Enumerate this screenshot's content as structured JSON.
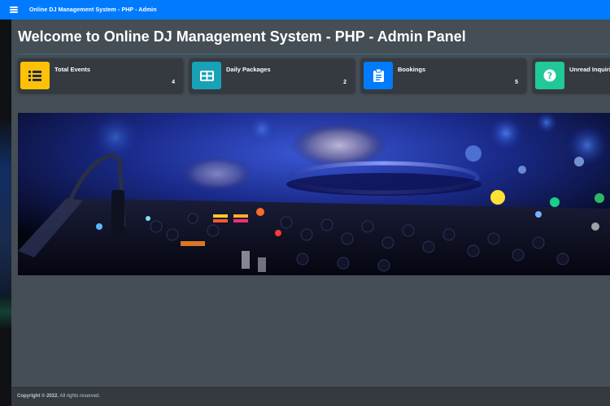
{
  "topbar": {
    "title": "Online DJ Management System - PHP - Admin",
    "color": "#007bff"
  },
  "page": {
    "title": "Welcome to Online DJ Management System - PHP - Admin Panel"
  },
  "cards": [
    {
      "label": "Total Events",
      "count": "4",
      "icon": "list-icon",
      "color": "#ffc107"
    },
    {
      "label": "Daily Packages",
      "count": "2",
      "icon": "table-icon",
      "color": "#17a2b8"
    },
    {
      "label": "Bookings",
      "count": "5",
      "icon": "clipboard-icon",
      "color": "#007bff"
    },
    {
      "label": "Unread Inquiries",
      "count": "",
      "icon": "question-circle-icon",
      "color": "#20c997"
    }
  ],
  "footer": {
    "copyright": "Copyright © 2022.",
    "rights": "All rights reserved."
  }
}
